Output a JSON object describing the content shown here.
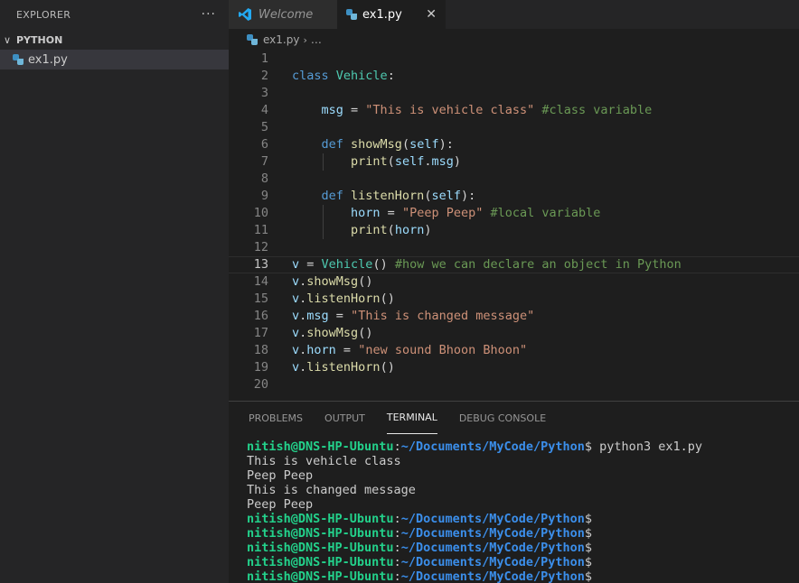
{
  "sidebar": {
    "title": "EXPLORER",
    "more": "···",
    "folder": "PYTHON",
    "file": "ex1.py"
  },
  "tabs": [
    {
      "label": "Welcome",
      "icon": "vscode-icon"
    },
    {
      "label": "ex1.py",
      "icon": "python-file-icon",
      "close": "✕"
    }
  ],
  "breadcrumb": {
    "file": "ex1.py",
    "separator": "›",
    "rest": "…"
  },
  "editor": {
    "current_line": 13,
    "lines": [
      {
        "n": "1",
        "tokens": []
      },
      {
        "n": "2",
        "tokens": [
          {
            "t": "class ",
            "c": "kw"
          },
          {
            "t": "Vehicle",
            "c": "cls"
          },
          {
            "t": ":",
            "c": "op"
          }
        ]
      },
      {
        "n": "3",
        "tokens": []
      },
      {
        "n": "4",
        "indent": 1,
        "tokens": [
          {
            "t": "    ",
            "c": "op"
          },
          {
            "t": "msg",
            "c": "var"
          },
          {
            "t": " = ",
            "c": "op"
          },
          {
            "t": "\"This is vehicle class\"",
            "c": "str"
          },
          {
            "t": " #class variable",
            "c": "cmt"
          }
        ]
      },
      {
        "n": "5",
        "tokens": []
      },
      {
        "n": "6",
        "tokens": [
          {
            "t": "    ",
            "c": "op"
          },
          {
            "t": "def ",
            "c": "kw"
          },
          {
            "t": "showMsg",
            "c": "fn"
          },
          {
            "t": "(",
            "c": "op"
          },
          {
            "t": "self",
            "c": "var"
          },
          {
            "t": "):",
            "c": "op"
          }
        ]
      },
      {
        "n": "7",
        "guide": true,
        "tokens": [
          {
            "t": "        ",
            "c": "op"
          },
          {
            "t": "print",
            "c": "fn"
          },
          {
            "t": "(",
            "c": "op"
          },
          {
            "t": "self",
            "c": "var"
          },
          {
            "t": ".",
            "c": "op"
          },
          {
            "t": "msg",
            "c": "var"
          },
          {
            "t": ")",
            "c": "op"
          }
        ]
      },
      {
        "n": "8",
        "tokens": []
      },
      {
        "n": "9",
        "tokens": [
          {
            "t": "    ",
            "c": "op"
          },
          {
            "t": "def ",
            "c": "kw"
          },
          {
            "t": "listenHorn",
            "c": "fn"
          },
          {
            "t": "(",
            "c": "op"
          },
          {
            "t": "self",
            "c": "var"
          },
          {
            "t": "):",
            "c": "op"
          }
        ]
      },
      {
        "n": "10",
        "guide": true,
        "tokens": [
          {
            "t": "        ",
            "c": "op"
          },
          {
            "t": "horn",
            "c": "var"
          },
          {
            "t": " = ",
            "c": "op"
          },
          {
            "t": "\"Peep Peep\"",
            "c": "str"
          },
          {
            "t": " #local variable",
            "c": "cmt"
          }
        ]
      },
      {
        "n": "11",
        "guide": true,
        "tokens": [
          {
            "t": "        ",
            "c": "op"
          },
          {
            "t": "print",
            "c": "fn"
          },
          {
            "t": "(",
            "c": "op"
          },
          {
            "t": "horn",
            "c": "var"
          },
          {
            "t": ")",
            "c": "op"
          }
        ]
      },
      {
        "n": "12",
        "tokens": []
      },
      {
        "n": "13",
        "tokens": [
          {
            "t": "v",
            "c": "var"
          },
          {
            "t": " = ",
            "c": "op"
          },
          {
            "t": "Vehicle",
            "c": "cls"
          },
          {
            "t": "() ",
            "c": "op"
          },
          {
            "t": "#how we can declare an object in Python",
            "c": "cmt"
          }
        ]
      },
      {
        "n": "14",
        "tokens": [
          {
            "t": "v",
            "c": "var"
          },
          {
            "t": ".",
            "c": "op"
          },
          {
            "t": "showMsg",
            "c": "fn"
          },
          {
            "t": "()",
            "c": "op"
          }
        ]
      },
      {
        "n": "15",
        "tokens": [
          {
            "t": "v",
            "c": "var"
          },
          {
            "t": ".",
            "c": "op"
          },
          {
            "t": "listenHorn",
            "c": "fn"
          },
          {
            "t": "()",
            "c": "op"
          }
        ]
      },
      {
        "n": "16",
        "tokens": [
          {
            "t": "v",
            "c": "var"
          },
          {
            "t": ".",
            "c": "op"
          },
          {
            "t": "msg",
            "c": "var"
          },
          {
            "t": " = ",
            "c": "op"
          },
          {
            "t": "\"This is changed message\"",
            "c": "str"
          }
        ]
      },
      {
        "n": "17",
        "tokens": [
          {
            "t": "v",
            "c": "var"
          },
          {
            "t": ".",
            "c": "op"
          },
          {
            "t": "showMsg",
            "c": "fn"
          },
          {
            "t": "()",
            "c": "op"
          }
        ]
      },
      {
        "n": "18",
        "tokens": [
          {
            "t": "v",
            "c": "var"
          },
          {
            "t": ".",
            "c": "op"
          },
          {
            "t": "horn",
            "c": "var"
          },
          {
            "t": " = ",
            "c": "op"
          },
          {
            "t": "\"new sound Bhoon Bhoon\"",
            "c": "str"
          }
        ]
      },
      {
        "n": "19",
        "tokens": [
          {
            "t": "v",
            "c": "var"
          },
          {
            "t": ".",
            "c": "op"
          },
          {
            "t": "listenHorn",
            "c": "fn"
          },
          {
            "t": "()",
            "c": "op"
          }
        ]
      },
      {
        "n": "20",
        "tokens": []
      }
    ]
  },
  "panel": {
    "tabs": [
      "PROBLEMS",
      "OUTPUT",
      "TERMINAL",
      "DEBUG CONSOLE"
    ],
    "active_tab": "TERMINAL"
  },
  "terminal": {
    "user": "nitish@DNS-HP-Ubuntu",
    "path": "~/Documents/MyCode/Python",
    "lines": [
      {
        "prompt": true,
        "cmd": " python3 ex1.py"
      },
      {
        "text": "This is vehicle class"
      },
      {
        "text": "Peep Peep"
      },
      {
        "text": "This is changed message"
      },
      {
        "text": "Peep Peep"
      },
      {
        "prompt": true,
        "cmd": ""
      },
      {
        "prompt": true,
        "cmd": ""
      },
      {
        "prompt": true,
        "cmd": ""
      },
      {
        "prompt": true,
        "cmd": ""
      },
      {
        "prompt": true,
        "cmd": ""
      }
    ]
  },
  "colors": {
    "background": "#1e1e1e",
    "sidebar": "#252526",
    "keyword": "#569cd6",
    "class": "#4ec9b0",
    "function": "#dcdcaa",
    "variable": "#9cdcfe",
    "string": "#ce9178",
    "comment": "#6a9955",
    "terminal_user": "#23d18b",
    "terminal_path": "#3b8eea"
  }
}
